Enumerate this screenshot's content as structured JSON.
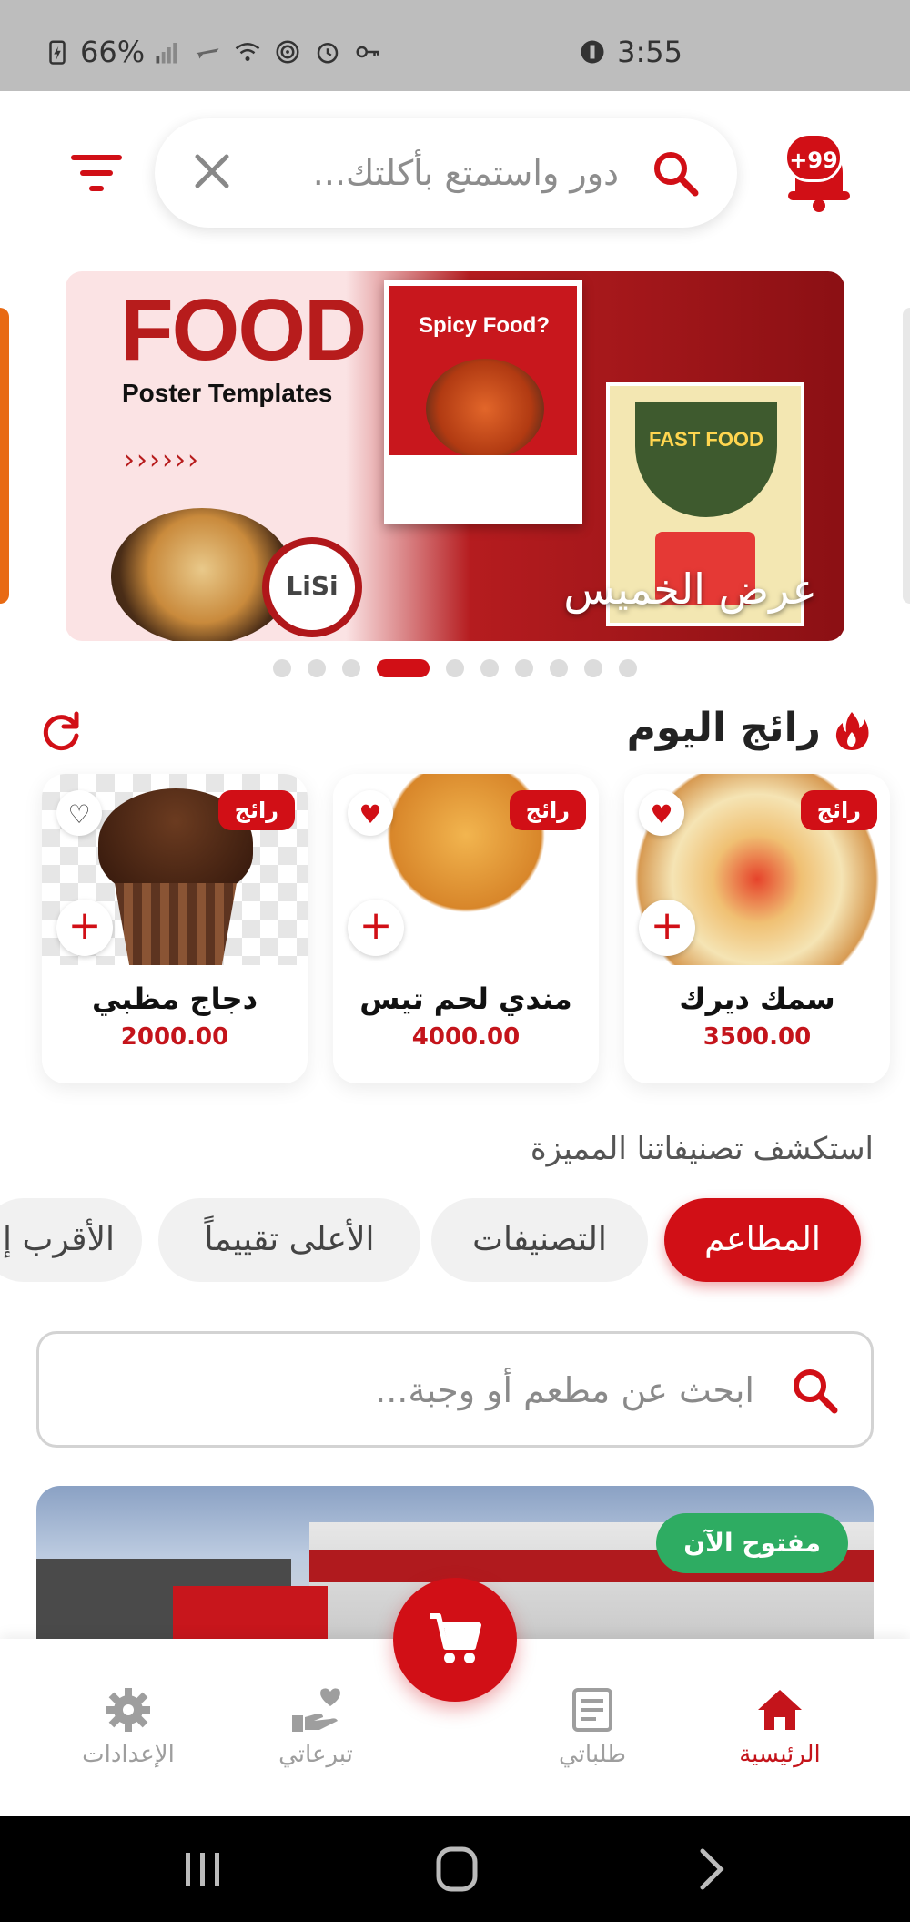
{
  "status_bar": {
    "battery": "66%",
    "time": "3:55"
  },
  "header": {
    "search_placeholder": "دور واستمتع بأكلتك...",
    "notification_badge": "+99"
  },
  "banner": {
    "title": "FOOD",
    "subtitle": "Poster Templates",
    "arrows": "››››››",
    "poster1_text": "Spicy Food?",
    "poster2_text": "FAST FOOD",
    "logo_text": "LiSi",
    "caption": "عرض الخميس",
    "dots_count": 10,
    "active_dot_index": 3
  },
  "trending": {
    "title": "رائج اليوم",
    "items": [
      {
        "tag": "رائج",
        "name": "سمك ديرك",
        "price": "3500.00",
        "favorite": true
      },
      {
        "tag": "رائج",
        "name": "مندي لحم تيس",
        "price": "4000.00",
        "favorite": true
      },
      {
        "tag": "رائج",
        "name": "دجاج مظبي",
        "price": "2000.00",
        "favorite": false
      }
    ]
  },
  "explore": {
    "title": "استكشف تصنيفاتنا المميزة",
    "chips": [
      "المطاعم",
      "التصنيفات",
      "الأعلى تقييماً",
      "الأقرب إ"
    ],
    "active_chip": 0
  },
  "restaurant_search": {
    "placeholder": "ابحث عن مطعم أو وجبة..."
  },
  "restaurant_card": {
    "status": "مفتوح الآن"
  },
  "bottom_nav": {
    "items": [
      "الرئيسية",
      "طلباتي",
      "تبرعاتي",
      "الإعدادات"
    ],
    "active": 0
  },
  "colors": {
    "primary": "#d10f16",
    "open": "#2eac62",
    "inactive": "#9e9e9e"
  }
}
